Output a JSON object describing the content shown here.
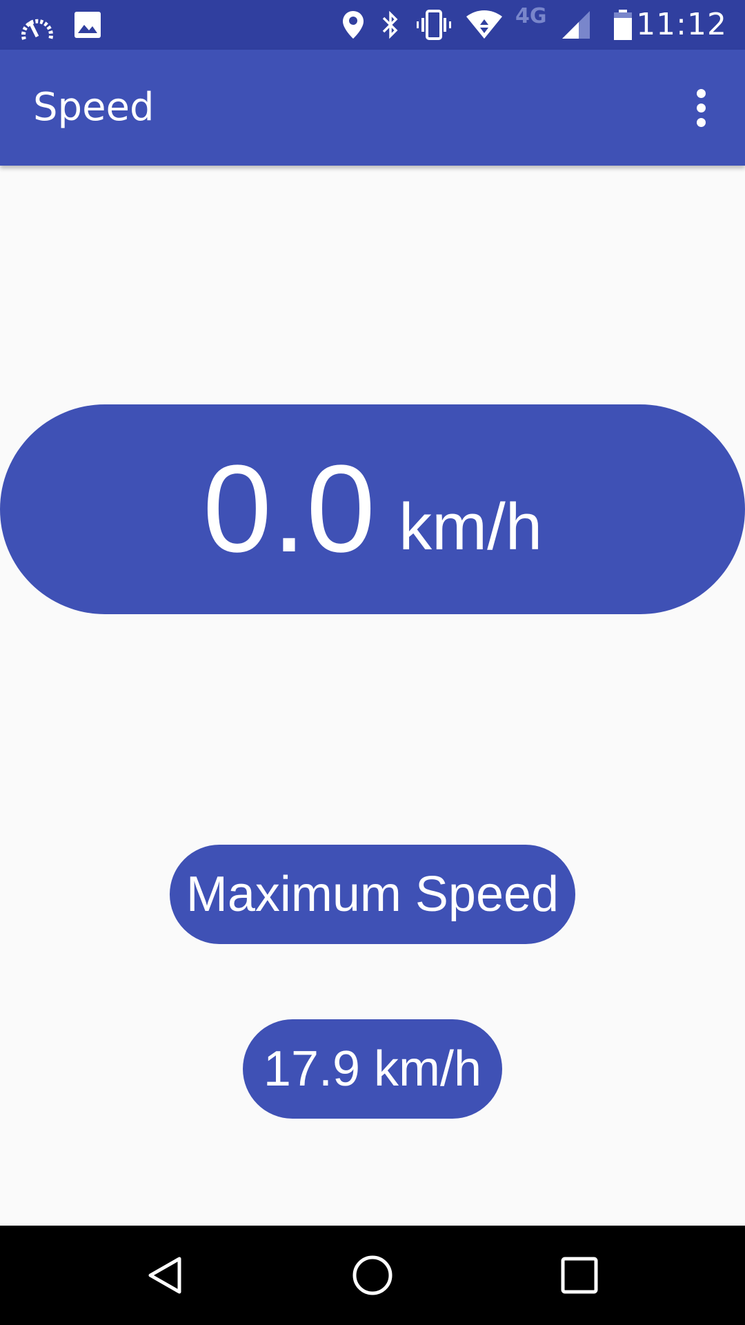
{
  "status_bar": {
    "time": "11:12",
    "network": "4G",
    "icons": [
      "speedometer-icon",
      "image-icon",
      "location-icon",
      "bluetooth-icon",
      "vibrate-icon",
      "wifi-icon",
      "signal-icon",
      "battery-icon"
    ]
  },
  "app_bar": {
    "title": "Speed",
    "overflow_icon": "more-vert-icon"
  },
  "speed": {
    "value": "0.0",
    "unit": "km/h"
  },
  "max_speed": {
    "label": "Maximum Speed",
    "value": "17.9 km/h"
  },
  "nav_bar": {
    "icons": [
      "back-icon",
      "home-icon",
      "recents-icon"
    ]
  },
  "colors": {
    "primary": "#3f51b5",
    "primary_dark": "#303f9f",
    "background": "#fafafa"
  }
}
